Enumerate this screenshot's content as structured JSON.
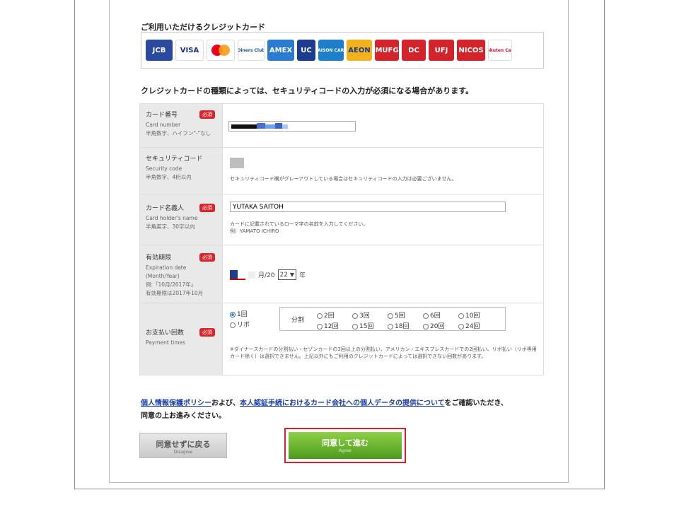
{
  "cards": {
    "title": "ご利用いただけるクレジットカード",
    "logos": [
      {
        "name": "jcb-logo",
        "text": "JCB",
        "bg": "#2a4aa0",
        "w": 38
      },
      {
        "name": "visa-logo",
        "text": "VISA",
        "bg": "#ffffff",
        "color": "#1a2f8f",
        "w": 40
      },
      {
        "name": "mastercard-logo",
        "text": "",
        "bg": "#ffffff",
        "w": 40
      },
      {
        "name": "diners-logo",
        "text": "Diners Club",
        "bg": "#ffffff",
        "color": "#1a4b9a",
        "w": 38
      },
      {
        "name": "amex-logo",
        "text": "AMEX",
        "bg": "#2b7bd0",
        "w": 38
      },
      {
        "name": "uc-logo",
        "text": "UC",
        "bg": "#1c3d8f",
        "w": 26
      },
      {
        "name": "saison-logo",
        "text": "SAISON CARD",
        "bg": "#1d7fc9",
        "w": 36
      },
      {
        "name": "aeon-logo",
        "text": "AEON",
        "bg": "#f2b21d",
        "color": "#1a3c8f",
        "w": 36
      },
      {
        "name": "mufg-logo",
        "text": "MUFG",
        "bg": "#d3232b",
        "w": 34
      },
      {
        "name": "dc-logo",
        "text": "DC",
        "bg": "#d3232b",
        "w": 34
      },
      {
        "name": "ufj-logo",
        "text": "UFJ",
        "bg": "#d3232b",
        "w": 36
      },
      {
        "name": "nicos-logo",
        "text": "NICOS",
        "bg": "#d3232b",
        "w": 40
      },
      {
        "name": "rakuten-logo",
        "text": "Rakuten Card",
        "bg": "#ffffff",
        "color": "#c8102e",
        "w": 34
      }
    ]
  },
  "notice": "クレジットカードの種類によっては、セキュリティコードの入力が必須になる場合があります。",
  "required_badge": "必須",
  "card_number": {
    "label_ja": "カード番号",
    "label_en": "Card number",
    "note": "半角数字、ハイフン\"-\"なし"
  },
  "security_code": {
    "label_ja": "セキュリティコード",
    "label_en": "Security code",
    "note": "半角数字、4桁以内",
    "hint": "セキュリティコード欄がグレーアウトしている場合はセキュリティコードの入力は必要ございません。"
  },
  "holder": {
    "label_ja": "カード名義人",
    "label_en": "Card holder's name",
    "note": "半角英字、30字以内",
    "value": "YUTAKA SAITOH",
    "hint1": "カードに記載されているローマ字の名前を入力してください。",
    "hint2": "例）YAMATO ICHIRO"
  },
  "expiry": {
    "label_ja": "有効期限",
    "label_en": "Expiration date (Month/Year)",
    "example": "例:「10月/2017年」",
    "example2": "有効期限は2017年10月",
    "month_label": "月/20",
    "year_value": "22",
    "year_label": "年"
  },
  "payment": {
    "label_ja": "お支払い回数",
    "label_en": "Payment times",
    "once": "1回",
    "revolving": "リボ",
    "split_label": "分割",
    "row1": [
      "2回",
      "3回",
      "5回",
      "6回",
      "10回"
    ],
    "row2": [
      "12回",
      "15回",
      "18回",
      "20回",
      "24回"
    ],
    "note": "※ダイナースカードの分割払い・セゾンカードの3回以上の分割払い、アメリカン・エキスプレスカードでの2回払い、リボ払い（リボ専用カード除く）は選択できません。上記以外にもご利用のクレジットカードによっては選択できない回数があります。"
  },
  "consent": {
    "link1": "個人情報保護ポリシー",
    "text1": "および、",
    "link2": "本人認証手続におけるカード会社への個人データの提供について",
    "text2": "をご確認いただき、",
    "text3": "同意の上お進みください。"
  },
  "buttons": {
    "back": "同意せずに戻る",
    "back_sub": "Disagree",
    "agree": "同意して進む",
    "agree_sub": "Agree"
  }
}
